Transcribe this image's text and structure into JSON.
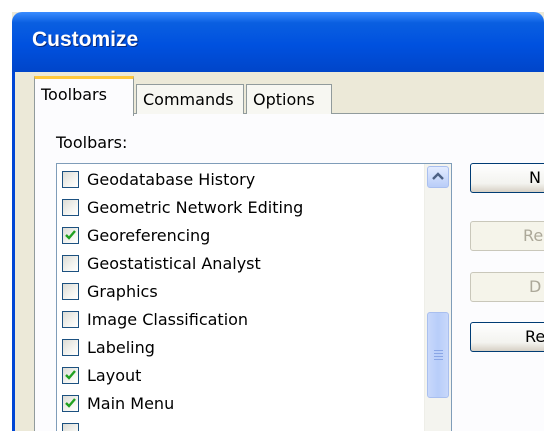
{
  "window": {
    "title": "Customize"
  },
  "tabs": [
    {
      "label": "Toolbars",
      "active": true
    },
    {
      "label": "Commands",
      "active": false
    },
    {
      "label": "Options",
      "active": false
    }
  ],
  "toolbars_section": {
    "label": "Toolbars:",
    "items": [
      {
        "label": "Geodatabase History",
        "checked": false
      },
      {
        "label": "Geometric Network Editing",
        "checked": false
      },
      {
        "label": "Georeferencing",
        "checked": true
      },
      {
        "label": "Geostatistical Analyst",
        "checked": false
      },
      {
        "label": "Graphics",
        "checked": false
      },
      {
        "label": "Image Classification",
        "checked": false
      },
      {
        "label": "Labeling",
        "checked": false
      },
      {
        "label": "Layout",
        "checked": true
      },
      {
        "label": "Main Menu",
        "checked": true
      }
    ]
  },
  "side_buttons": [
    {
      "label": "N",
      "enabled": true
    },
    {
      "label": "Ren",
      "enabled": false
    },
    {
      "label": "D",
      "enabled": false
    },
    {
      "label": "Re",
      "enabled": true
    }
  ],
  "colors": {
    "titlebar": "#0051df",
    "active_tab_highlight": "#ffc83c",
    "check_mark": "#21a121"
  }
}
